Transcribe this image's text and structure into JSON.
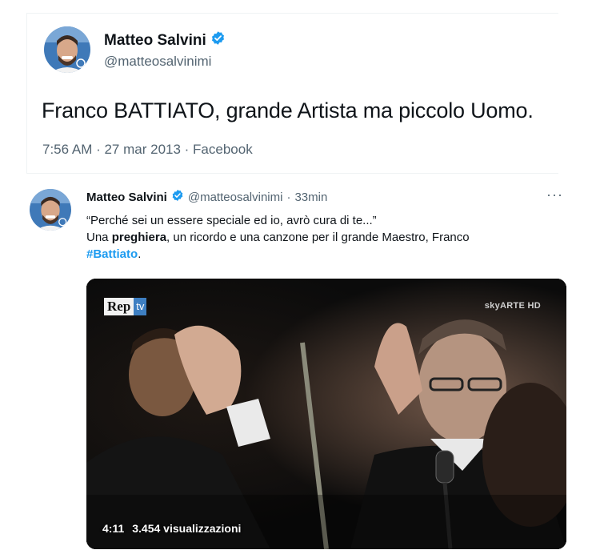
{
  "tweet1": {
    "name": "Matteo Salvini",
    "handle": "@matteosalvinimi",
    "text": "Franco BATTIATO, grande Artista ma piccolo Uomo.",
    "meta": "7:56 AM · 27 mar 2013 · Facebook"
  },
  "tweet2": {
    "name": "Matteo Salvini",
    "handle": "@matteosalvinimi",
    "sep": "·",
    "time": "33min",
    "more": "···",
    "line1": "“Perché sei un essere speciale ed io, avrò cura di te...”",
    "line2_a": "Una ",
    "line2_bold": "preghiera",
    "line2_b": ", un ricordo e una canzone per il grande Maestro, Franco",
    "hashtag": "#Battiato",
    "end": ".",
    "video": {
      "logo_a": "Rep",
      "logo_b": "tv",
      "channel": "skyARTE HD",
      "duration": "4:11",
      "views": "3.454 visualizzazioni"
    }
  },
  "colors": {
    "verified": "#1d9bf0",
    "hashtag": "#1d9bf0",
    "muted": "#536471"
  },
  "icons": [
    "verified-badge-icon",
    "more-options-icon"
  ]
}
